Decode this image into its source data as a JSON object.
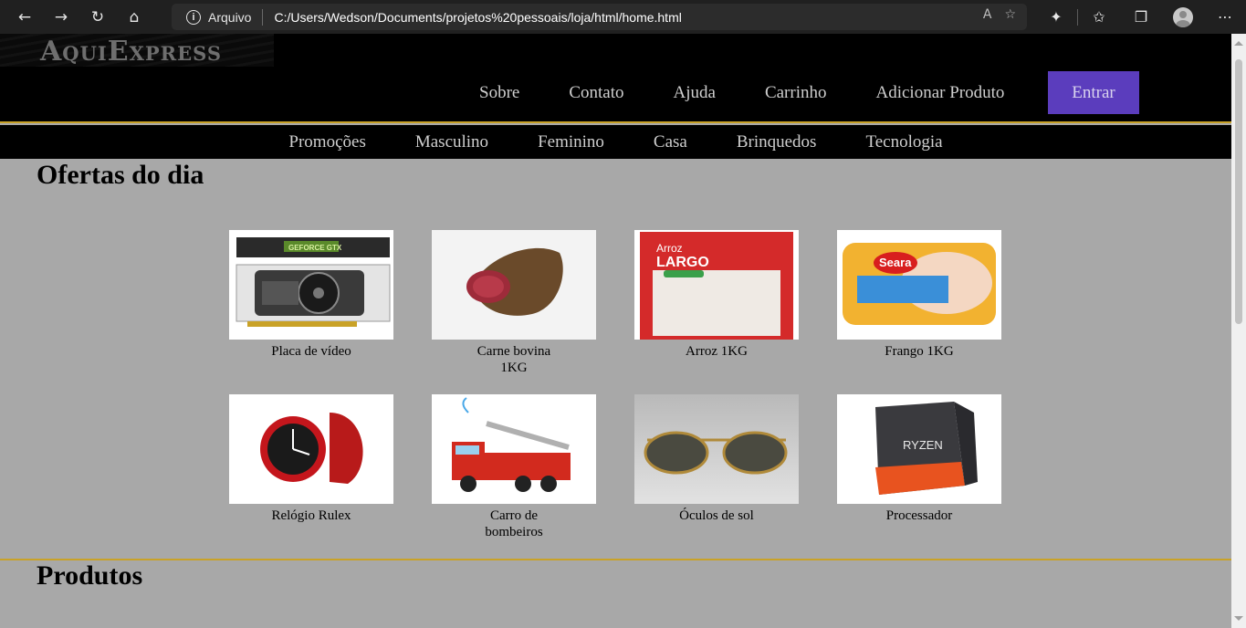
{
  "browser": {
    "address_label": "Arquivo",
    "url": "C:/Users/Wedson/Documents/projetos%20pessoais/loja/html/home.html"
  },
  "header": {
    "logo": "AquiExpress",
    "nav": [
      "Sobre",
      "Contato",
      "Ajuda",
      "Carrinho",
      "Adicionar Produto"
    ],
    "login_label": "Entrar"
  },
  "categories": [
    "Promoções",
    "Masculino",
    "Feminino",
    "Casa",
    "Brinquedos",
    "Tecnologia"
  ],
  "offers": {
    "title": "Ofertas do dia",
    "items": [
      {
        "label": "Placa de vídeo",
        "image": "graphics-card"
      },
      {
        "label": "Carne bovina 1KG",
        "image": "beef"
      },
      {
        "label": "Arroz 1KG",
        "image": "rice-bag"
      },
      {
        "label": "Frango 1KG",
        "image": "chicken-pack"
      },
      {
        "label": "Relógio Rulex",
        "image": "watch"
      },
      {
        "label": "Carro de bombeiros",
        "image": "fire-truck"
      },
      {
        "label": "Óculos de sol",
        "image": "sunglasses"
      },
      {
        "label": "Processador",
        "image": "processor-box"
      }
    ],
    "image_texts": {
      "gpu": "GEFORCE GTX",
      "rice_brand": "Arroz",
      "rice_name": "LARGO",
      "chicken_brand": "Seara",
      "cpu": "RYZEN"
    }
  },
  "products": {
    "title": "Produtos"
  },
  "colors": {
    "accent_gold": "#c9a227",
    "login_purple": "#5b3dbd",
    "header_bg": "#000000",
    "page_bg": "#a8a8a8"
  }
}
